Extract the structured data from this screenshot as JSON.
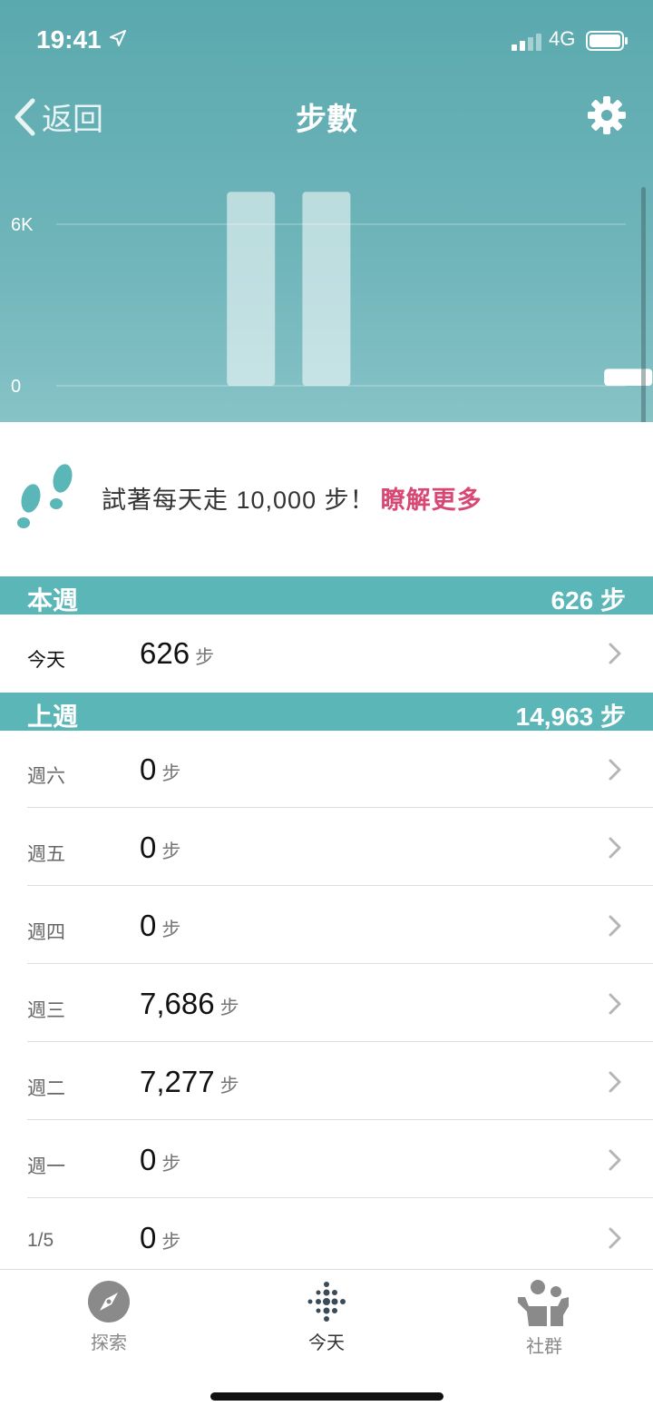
{
  "status_bar": {
    "time": "19:41",
    "network": "4G"
  },
  "nav": {
    "back_label": "返回",
    "title": "步數"
  },
  "chart_data": {
    "type": "bar",
    "categories": [
      "1/5",
      "週一",
      "週二",
      "週三",
      "週四",
      "週五",
      "週六",
      "今天"
    ],
    "values": [
      0,
      0,
      7277,
      7686,
      0,
      0,
      0,
      626
    ],
    "highlight_index": 7,
    "yticks": [
      {
        "label": "0",
        "value": 0
      },
      {
        "label": "6K",
        "value": 6000
      }
    ],
    "ylim": [
      0,
      6000
    ],
    "grid": true,
    "colors": {
      "bar": "rgba(255,255,255,0.55)",
      "highlight": "#ffffff"
    }
  },
  "tip": {
    "text": "試著每天走 10,000 步！",
    "link": "瞭解更多",
    "link_color": "#d84875"
  },
  "this_week": {
    "label": "本週",
    "total": "626 步",
    "rows": [
      {
        "day": "今天",
        "steps": "626",
        "unit": "步"
      }
    ]
  },
  "last_week": {
    "label": "上週",
    "total": "14,963 步",
    "rows": [
      {
        "day": "週六",
        "steps": "0",
        "unit": "步"
      },
      {
        "day": "週五",
        "steps": "0",
        "unit": "步"
      },
      {
        "day": "週四",
        "steps": "0",
        "unit": "步"
      },
      {
        "day": "週三",
        "steps": "7,686",
        "unit": "步"
      },
      {
        "day": "週二",
        "steps": "7,277",
        "unit": "步"
      },
      {
        "day": "週一",
        "steps": "0",
        "unit": "步"
      },
      {
        "day": "1/5",
        "steps": "0",
        "unit": "步"
      }
    ]
  },
  "tabs": [
    {
      "label": "探索",
      "icon": "compass-icon"
    },
    {
      "label": "今天",
      "icon": "fitbit-dots-icon"
    },
    {
      "label": "社群",
      "icon": "people-icon"
    }
  ],
  "colors": {
    "header": "#5aa9ae",
    "section": "#5ab6b7",
    "accent_pink": "#d84875"
  }
}
